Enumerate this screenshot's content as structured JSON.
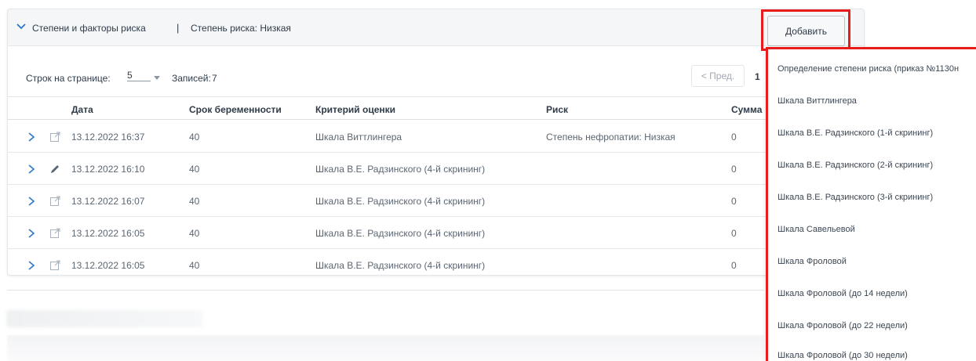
{
  "panel": {
    "title": "Степени и факторы риска",
    "separator": "|",
    "risk_label": "Степень риска: Низкая"
  },
  "toolbar": {
    "add_label": "Добавить"
  },
  "pager": {
    "rows_label": "Строк на странице:",
    "rows_value": "5",
    "records_label": "Записей:",
    "records_value": "7",
    "prev_label": "< Пред.",
    "current_page": "1"
  },
  "table": {
    "columns": [
      "Дата",
      "Срок беременности",
      "Критерий оценки",
      "Риск",
      "Сумма"
    ],
    "rows": [
      {
        "action_icon": "view-icon",
        "date": "13.12.2022 16:37",
        "term": "40",
        "criterion": "Шкала Виттлингера",
        "risk": "Степень нефропатии: Низкая",
        "sum": "0"
      },
      {
        "action_icon": "pencil-icon",
        "date": "13.12.2022 16:10",
        "term": "40",
        "criterion": "Шкала В.Е. Радзинского (4-й скрининг)",
        "risk": "",
        "sum": "0"
      },
      {
        "action_icon": "view-icon",
        "date": "13.12.2022 16:07",
        "term": "40",
        "criterion": "Шкала В.Е. Радзинского (4-й скрининг)",
        "risk": "",
        "sum": "0"
      },
      {
        "action_icon": "view-icon",
        "date": "13.12.2022 16:05",
        "term": "40",
        "criterion": "Шкала В.Е. Радзинского (4-й скрининг)",
        "risk": "",
        "sum": "0"
      },
      {
        "action_icon": "view-icon",
        "date": "13.12.2022 16:05",
        "term": "40",
        "criterion": "Шкала В.Е. Радзинского (4-й скрининг)",
        "risk": "",
        "sum": "0"
      }
    ]
  },
  "dropdown": {
    "items": [
      "Определение степени риска (приказ №1130н",
      "Шкала Виттлингера",
      "Шкала В.Е. Радзинского (1-й скрининг)",
      "Шкала В.Е. Радзинского (2-й скрининг)",
      "Шкала В.Е. Радзинского (3-й скрининг)",
      "Шкала Савельевой",
      "Шкала Фроловой",
      "Шкала Фроловой (до 14 недели)",
      "Шкала Фроловой (до 22 недели)",
      "Шкала Фроловой (до 30 недели)"
    ]
  },
  "colors": {
    "highlight": "#ea1b1b",
    "text": "#2f3b48",
    "muted": "#5b6672",
    "icon": "#2a77c9"
  }
}
